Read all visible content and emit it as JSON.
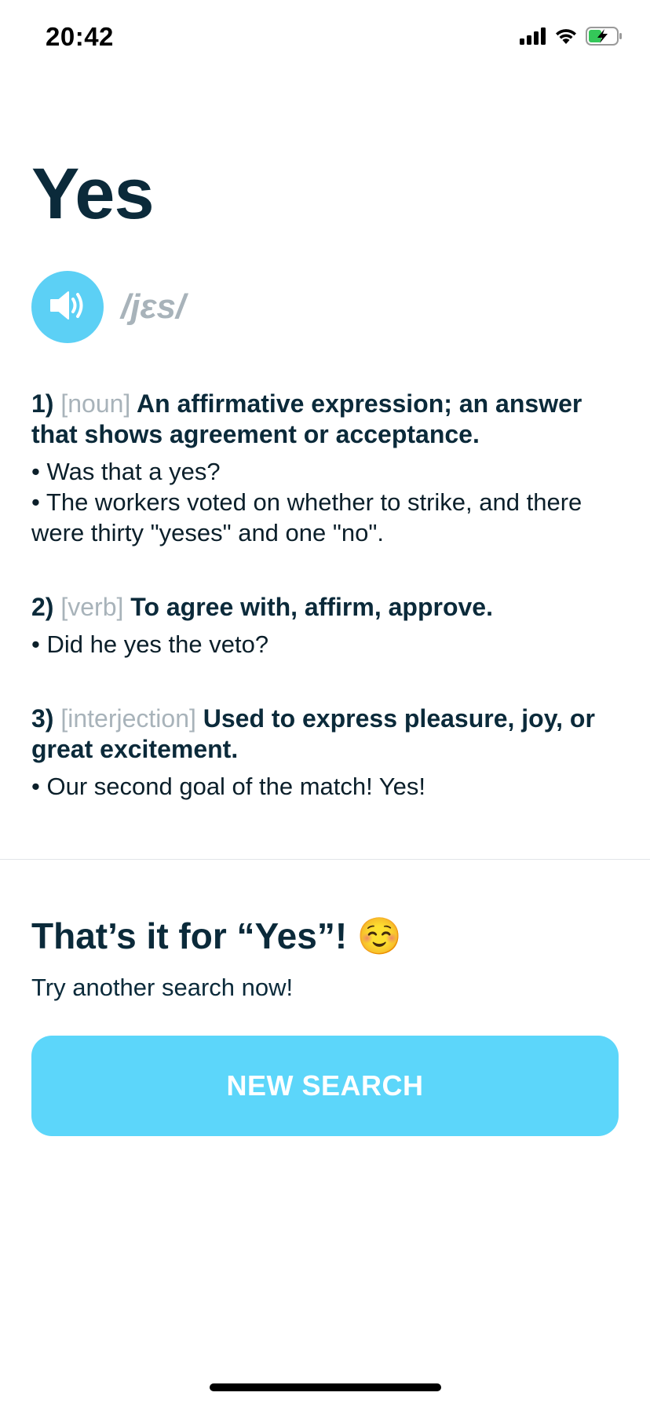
{
  "status_bar": {
    "time": "20:42",
    "icons": [
      "signal-icon",
      "wifi-icon",
      "battery-charging-icon"
    ]
  },
  "word": {
    "title": "Yes",
    "phonetic": "/jɛs/",
    "speaker_icon": "speaker-icon"
  },
  "definitions": [
    {
      "number": "1)",
      "pos": "[noun]",
      "meaning": "An affirmative expression; an answer that shows agreement or acceptance.",
      "examples": [
        "• Was that a yes?",
        "• The workers voted on whether to strike, and there were thirty \"yeses\" and one \"no\"."
      ]
    },
    {
      "number": "2)",
      "pos": "[verb]",
      "meaning": "To agree with, affirm, approve.",
      "examples": [
        "• Did he yes the veto?"
      ]
    },
    {
      "number": "3)",
      "pos": "[interjection]",
      "meaning": "Used to express pleasure, joy, or great excitement.",
      "examples": [
        "• Our second goal of the match! Yes!"
      ]
    }
  ],
  "end_section": {
    "title": "That’s it for “Yes”!",
    "emoji": "☺️",
    "subtitle": "Try another search now!",
    "button_label": "NEW SEARCH"
  },
  "colors": {
    "accent": "#5cd6fa",
    "heading": "#0b2a3a",
    "muted": "#a8b3ba"
  }
}
